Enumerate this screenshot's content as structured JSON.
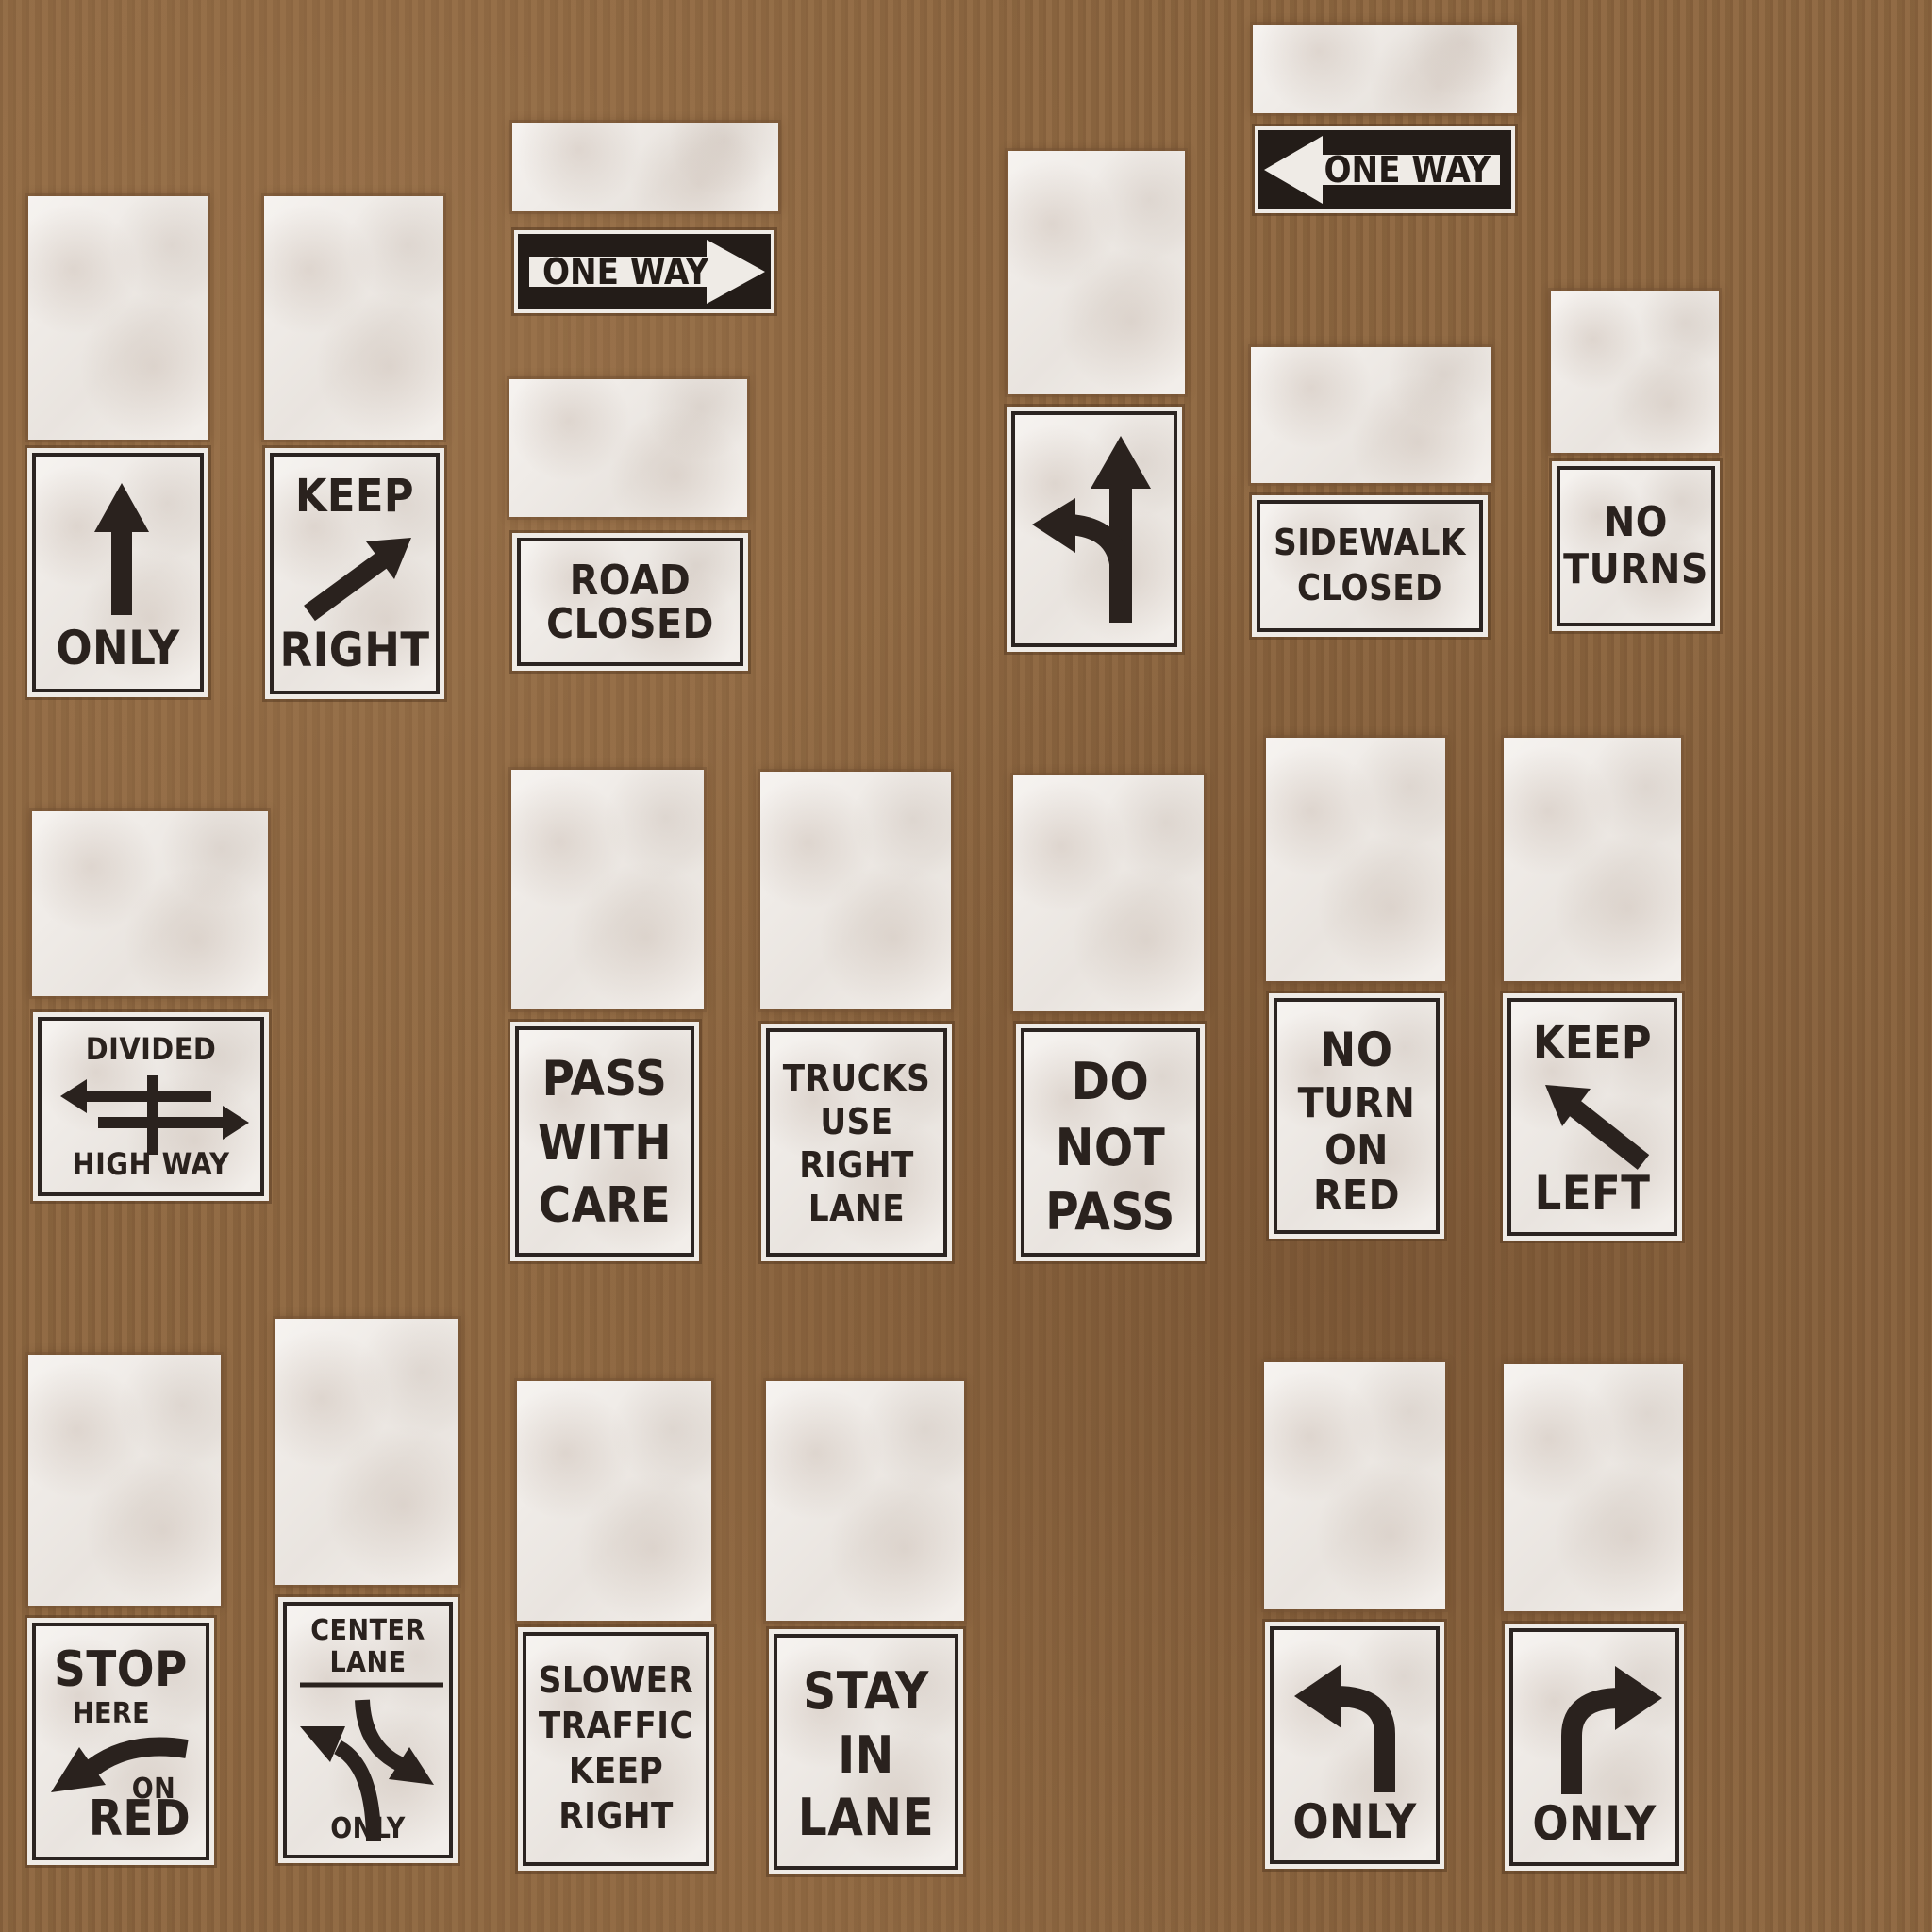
{
  "signs": {
    "straight_only": {
      "bottom": "ONLY"
    },
    "keep_right": {
      "top": "KEEP",
      "bottom": "RIGHT"
    },
    "one_way_right": {
      "text": "ONE WAY"
    },
    "road_closed": {
      "line1": "ROAD",
      "line2": "CLOSED"
    },
    "left_or_straight": {},
    "one_way_left": {
      "text": "ONE WAY"
    },
    "sidewalk_closed": {
      "line1": "SIDEWALK",
      "line2": "CLOSED"
    },
    "no_turns": {
      "line1": "NO",
      "line2": "TURNS"
    },
    "divided_highway": {
      "top": "DIVIDED",
      "bottom": "HIGH WAY"
    },
    "pass_with_care": {
      "line1": "PASS",
      "line2": "WITH",
      "line3": "CARE"
    },
    "trucks_right_lane": {
      "line1": "TRUCKS",
      "line2": "USE",
      "line3": "RIGHT",
      "line4": "LANE"
    },
    "do_not_pass": {
      "line1": "DO",
      "line2": "NOT",
      "line3": "PASS"
    },
    "no_turn_on_red": {
      "line1": "NO",
      "line2": "TURN",
      "line3": "ON",
      "line4": "RED"
    },
    "keep_left": {
      "top": "KEEP",
      "bottom": "LEFT"
    },
    "stop_here_on_red": {
      "line1": "STOP",
      "line2": "HERE",
      "line3": "ON",
      "line4": "RED"
    },
    "center_lane_only": {
      "line1": "CENTER",
      "line2": "LANE",
      "bottom": "ONLY"
    },
    "slower_traffic": {
      "line1": "SLOWER",
      "line2": "TRAFFIC",
      "line3": "KEEP",
      "line4": "RIGHT"
    },
    "stay_in_lane": {
      "line1": "STAY",
      "line2": "IN",
      "line3": "LANE"
    },
    "left_turn_only": {
      "bottom": "ONLY"
    },
    "right_turn_only": {
      "bottom": "ONLY"
    }
  },
  "colors": {
    "background": "#8e6842",
    "sign_white": "#f3efeb",
    "ink": "#2a221e"
  },
  "icons": [
    "arrow-up-icon",
    "arrow-up-right-icon",
    "arrow-right-icon",
    "arrow-left-icon",
    "left-or-straight-icon",
    "divided-highway-icon",
    "arrow-up-left-icon",
    "curve-left-arrow-icon",
    "two-way-left-turn-icon",
    "turn-left-icon",
    "turn-right-icon"
  ]
}
